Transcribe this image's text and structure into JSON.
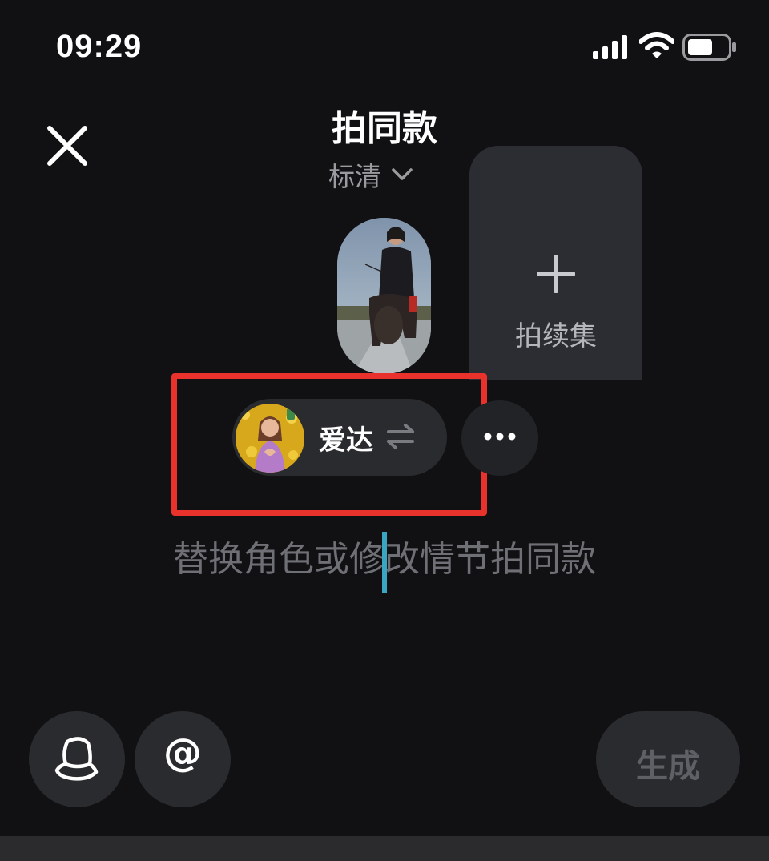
{
  "status_bar": {
    "time": "09:29"
  },
  "header": {
    "title": "拍同款",
    "quality": "标清"
  },
  "sequel_card": {
    "label": "拍续集"
  },
  "character_chip": {
    "name": "爱达"
  },
  "prompt": {
    "placeholder": "替换角色或修改情节拍同款"
  },
  "toolbar": {
    "at_label": "@",
    "generate_label": "生成"
  },
  "colors": {
    "background": "#111113",
    "highlight_border": "#e8322b",
    "caret": "#3aa6c2",
    "chip_bg": "#2a2b2f"
  },
  "icons": [
    "signal-icon",
    "wifi-icon",
    "battery-icon",
    "close-icon",
    "chevron-down-icon",
    "plus-icon",
    "swap-icon",
    "more-icon",
    "hat-icon"
  ]
}
